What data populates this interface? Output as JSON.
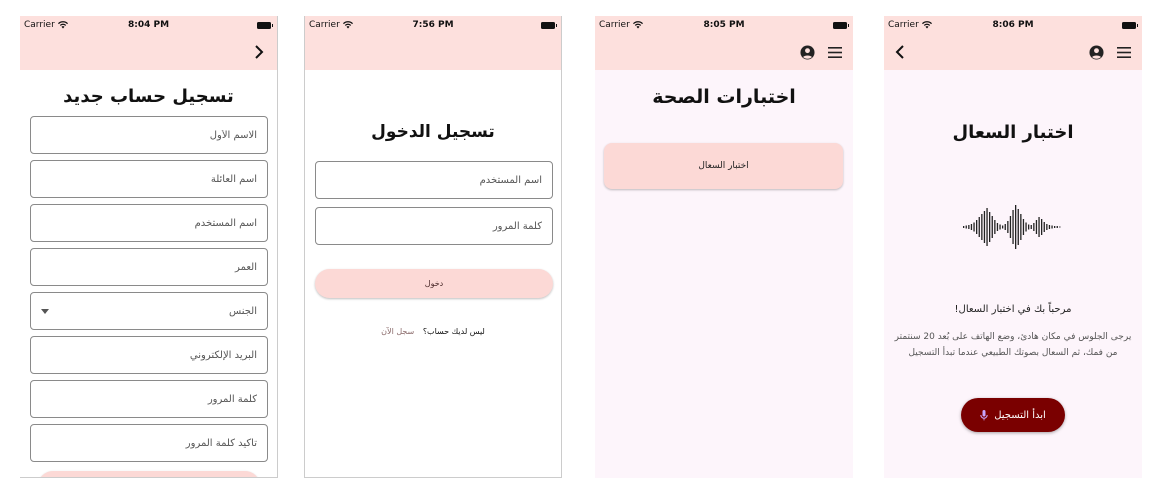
{
  "status": {
    "carrier": "Carrier"
  },
  "screens": [
    {
      "time": "8:04 PM",
      "title": "تسجيل حساب جديد",
      "fields": [
        "الاسم الأول",
        "اسم العائلة",
        "اسم المستخدم",
        "العمر"
      ],
      "gender_select": "الجنس",
      "fields2": [
        "البريد الإلكتروني",
        "كلمة المرور",
        "تأكيد كلمة المرور"
      ]
    },
    {
      "time": "7:56 PM",
      "title": "تسجيل الدخول",
      "username_placeholder": "اسم المستخدم",
      "password_placeholder": "كلمة المرور",
      "login_button": "دخول",
      "no_account": "ليس لديك حساب؟",
      "register_link": "سجل الآن"
    },
    {
      "time": "8:05 PM",
      "title": "اختبارات الصحة",
      "test_item": "اختبار السعال"
    },
    {
      "time": "8:06 PM",
      "title": "اختبار السعال",
      "welcome": "!مرحباً بك في اختبار السعال",
      "instructions": "يرجى الجلوس في مكان هادئ، وضع الهاتف على بُعد 20 سنتمتر من فمك، ثم السعال بصوتك الطبيعي عندما تبدأ التسجيل",
      "record_button": "ابدأ التسجيل"
    }
  ],
  "colors": {
    "header_pink": "#fde0dd",
    "button_pink": "#fcd9d6",
    "record_red": "#7a0000",
    "lavender_bg": "#fdf5fb"
  }
}
